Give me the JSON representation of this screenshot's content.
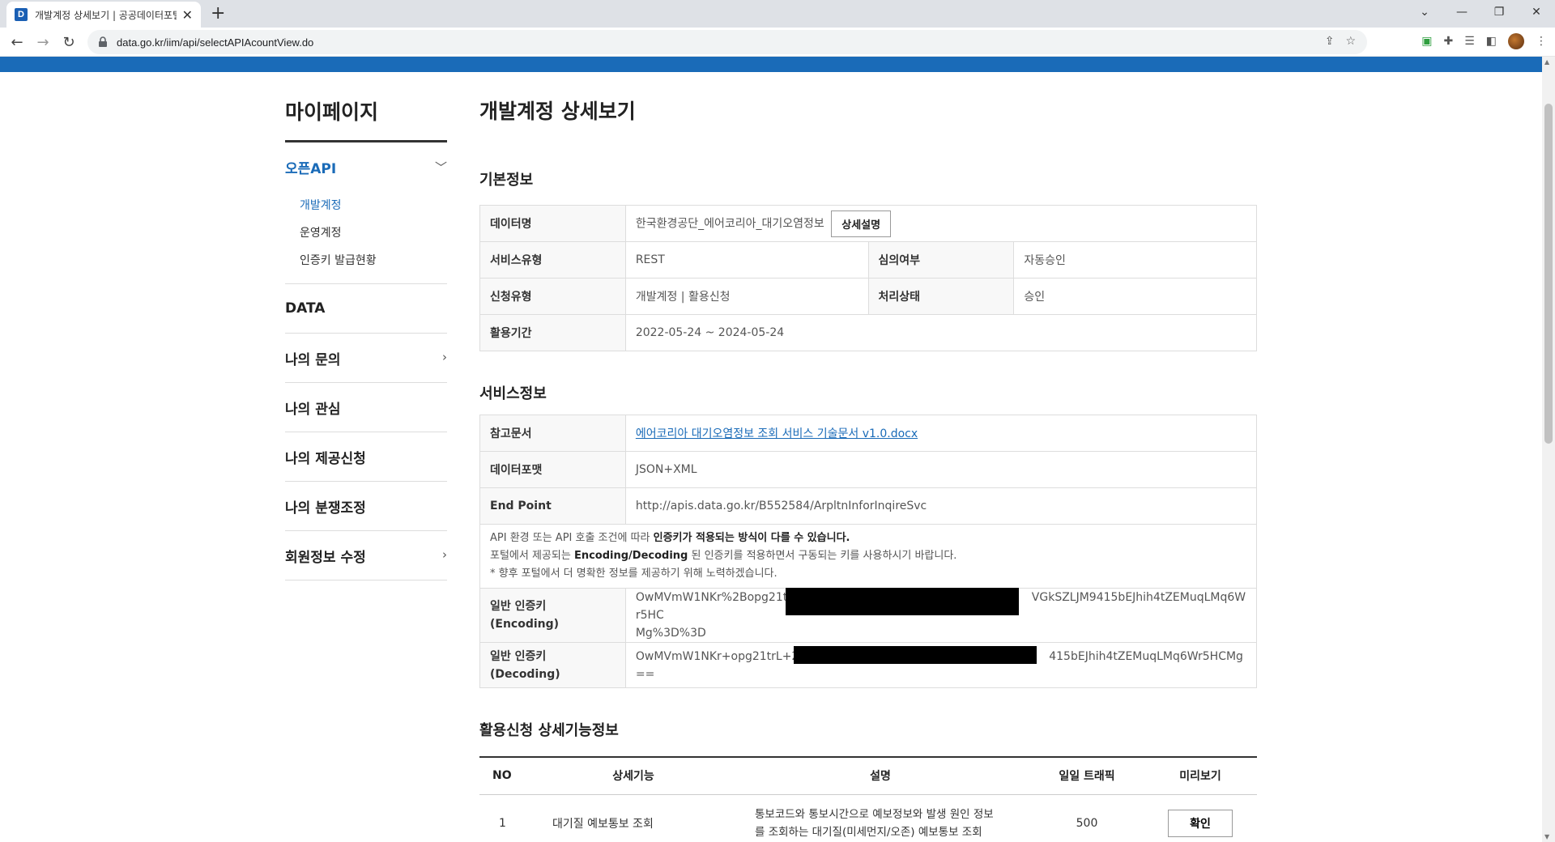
{
  "browser": {
    "tab_title": "개발계정 상세보기 | 공공데이터포털",
    "favicon_letter": "D",
    "url": "data.go.kr/iim/api/selectAPIAcountView.do"
  },
  "sidebar": {
    "title": "마이페이지",
    "openapi": {
      "label": "오픈API",
      "items": [
        "개발계정",
        "운영계정",
        "인증키 발급현황"
      ]
    },
    "data_label": "DATA",
    "my_inquiry": "나의 문의",
    "my_interest": "나의 관심",
    "my_offer": "나의 제공신청",
    "my_dispute": "나의 분쟁조정",
    "member_edit": "회원정보 수정"
  },
  "main": {
    "title": "개발계정 상세보기",
    "basic": {
      "section_title": "기본정보",
      "data_name_label": "데이터명",
      "data_name": "한국환경공단_에어코리아_대기오염정보",
      "detail_button": "상세설명",
      "service_type_label": "서비스유형",
      "service_type": "REST",
      "review_label": "심의여부",
      "review": "자동승인",
      "apply_type_label": "신청유형",
      "apply_type": "개발계정 | 활용신청",
      "status_label": "처리상태",
      "status": "승인",
      "period_label": "활용기간",
      "period": "2022-05-24 ~ 2024-05-24"
    },
    "service": {
      "section_title": "서비스정보",
      "ref_doc_label": "참고문서",
      "ref_doc": "에어코리아 대기오염정보 조회 서비스 기술문서 v1.0.docx",
      "format_label": "데이터포맷",
      "format": "JSON+XML",
      "endpoint_label": "End Point",
      "endpoint": "http://apis.data.go.kr/B552584/ArpltnInforInqireSvc",
      "note1_a": "API 환경 또는 API 호출 조건에 따라 ",
      "note1_b": "인증키가 적용되는 방식이 다를 수 있습니다.",
      "note2_a": "포털에서 제공되는 ",
      "note2_b": "Encoding/Decoding",
      "note2_c": " 된 인증키를 적용하면서 구동되는 키를 사용하시기 바랍니다.",
      "note3": "* 향후 포털에서 더 명확한 정보를 제공하기 위해 노력하겠습니다.",
      "enc_label_1": "일반 인증키",
      "enc_label_2": "(Encoding)",
      "enc_key_start": "OwMVmW1NKr%2Bopg21trL",
      "enc_key_end": "VGkSZLJM9415bEJhih4tZEMuqLMq6Wr5HC",
      "enc_key_line2": "Mg%3D%3D",
      "dec_label_1": "일반 인증키",
      "dec_label_2": "(Decoding)",
      "dec_key_start": "OwMVmW1NKr+opg21trL+2g",
      "dec_key_end": "415bEJhih4tZEMuqLMq6Wr5HCMg=="
    },
    "features": {
      "section_title": "활용신청 상세기능정보",
      "columns": [
        "NO",
        "상세기능",
        "설명",
        "일일 트래픽",
        "미리보기"
      ],
      "rows": [
        {
          "no": "1",
          "name": "대기질 예보통보 조회",
          "desc": "통보코드와 통보시간으로 예보정보와 발생 원인 정보를 조회하는 대기질(미세먼지/오존) 예보통보 조회",
          "traffic": "500",
          "preview": "확인"
        }
      ]
    }
  }
}
